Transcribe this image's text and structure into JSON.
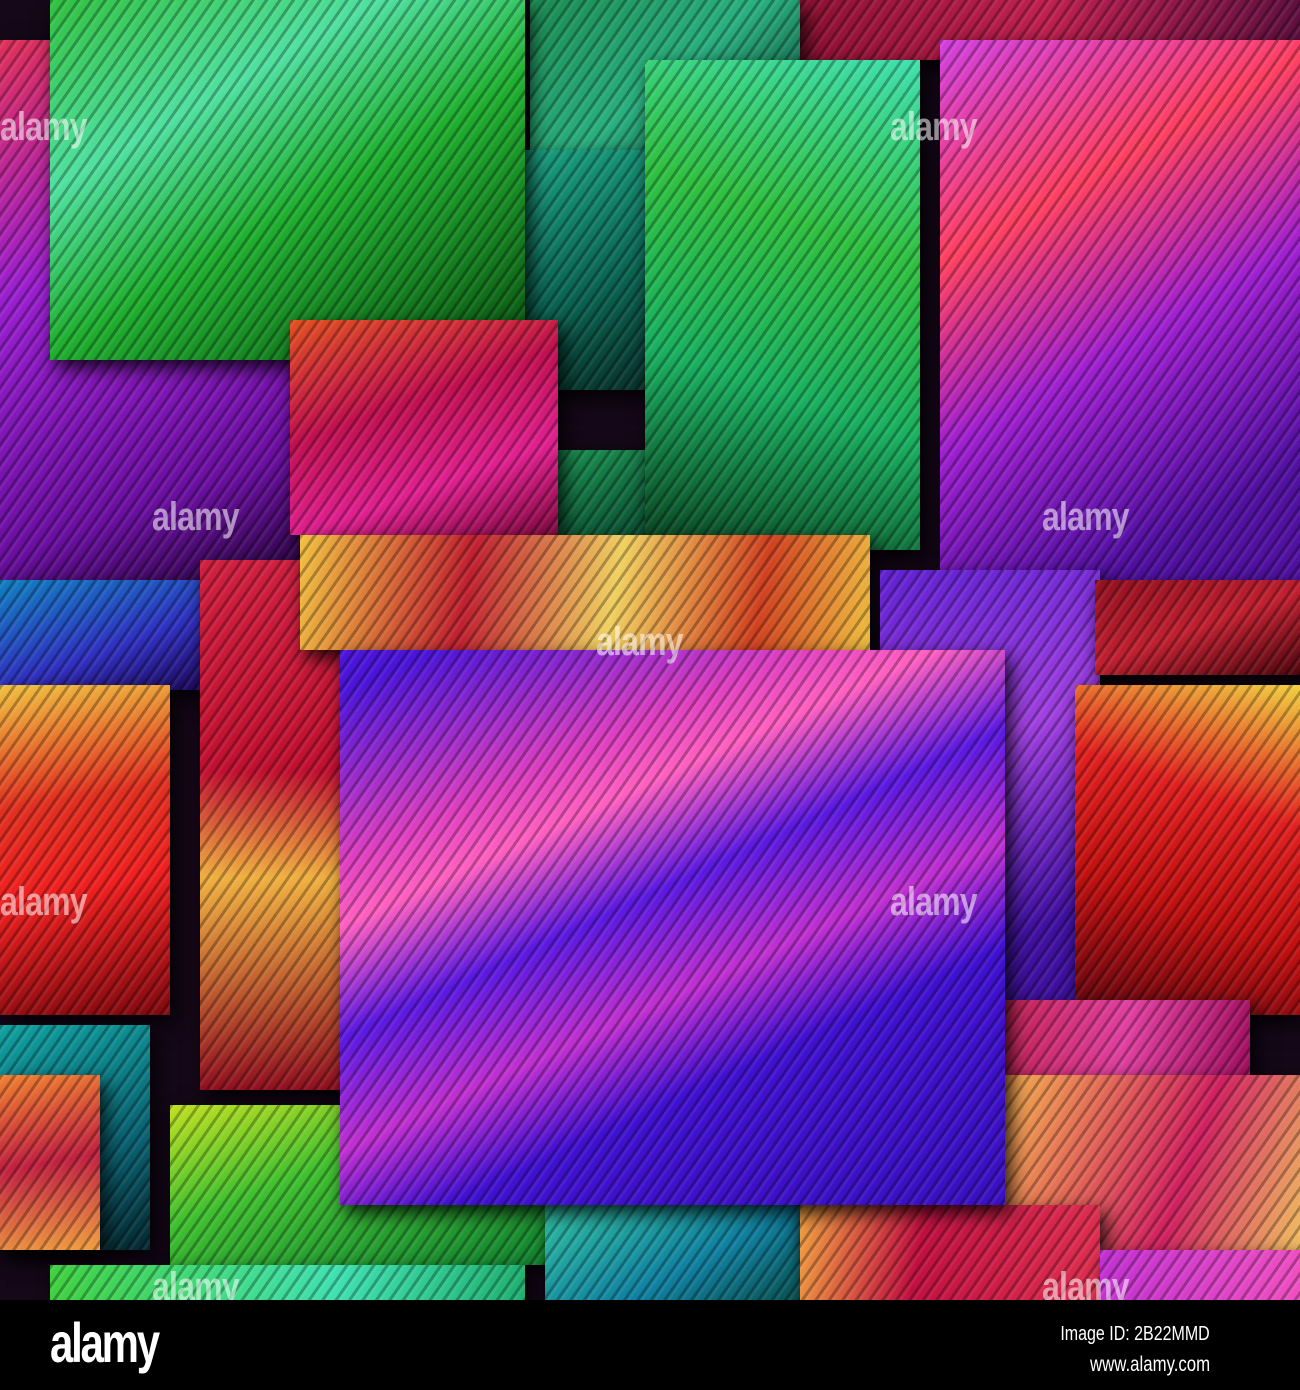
{
  "watermark": "alamy",
  "footer": {
    "logo": "alamy",
    "image_id": "Image ID: 2B22MMD",
    "website": "www.alamy.com"
  },
  "palette": {
    "green": "#2fd13a",
    "teal": "#19c79a",
    "purple": "#9a1fd0",
    "magenta": "#e02fc8",
    "indigo": "#4b14d8",
    "red": "#d81a2a",
    "gold": "#f0c040",
    "background": "#000000"
  }
}
